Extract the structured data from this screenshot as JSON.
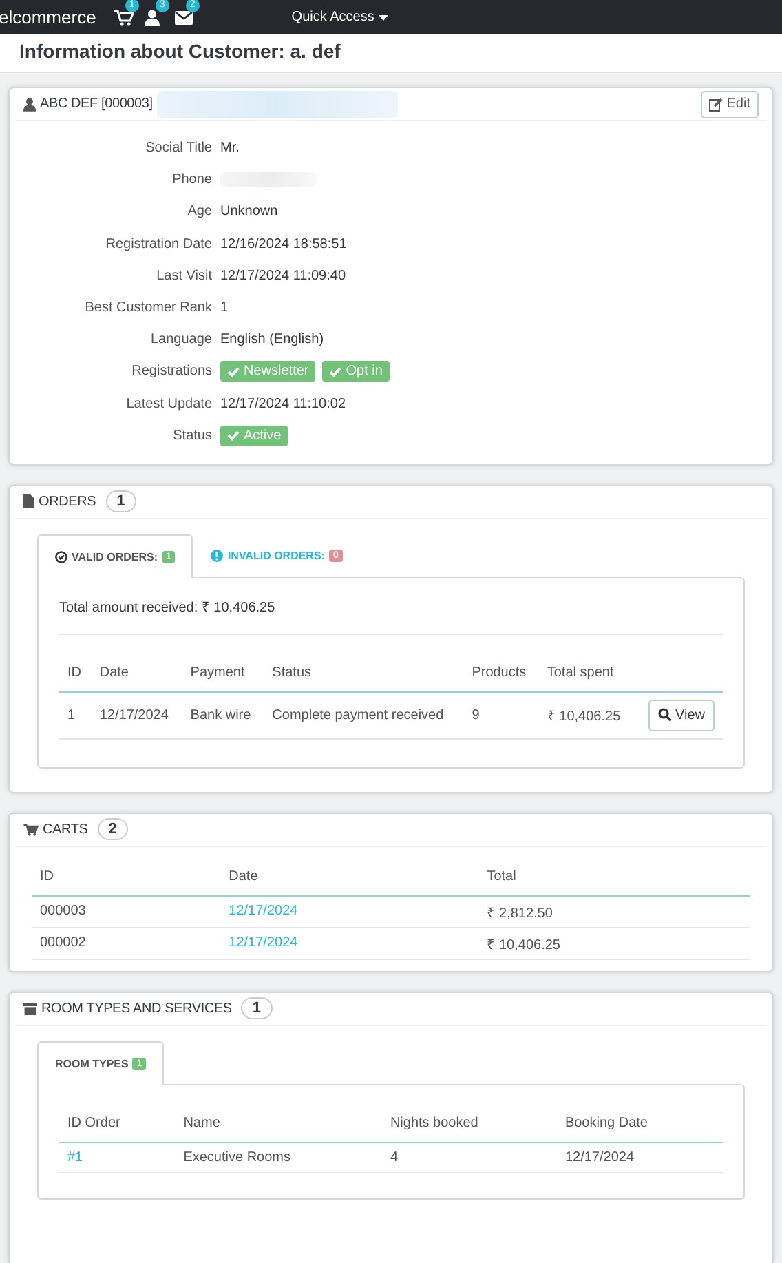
{
  "topbar": {
    "brand": "elcommerce",
    "icons": [
      {
        "kind": "cart",
        "count": "1"
      },
      {
        "kind": "user",
        "count": "3"
      },
      {
        "kind": "mail",
        "count": "2"
      }
    ],
    "quick_access": "Quick Access"
  },
  "page_title": "Information about Customer: a. def",
  "customer": {
    "heading": "ABC DEF [000003]",
    "edit": "Edit",
    "fields": [
      {
        "label": "Social Title",
        "kind": "text",
        "value": "Mr."
      },
      {
        "label": "Phone",
        "kind": "blurred"
      },
      {
        "label": "Age",
        "kind": "text",
        "value": "Unknown"
      },
      {
        "label": "Registration Date",
        "kind": "text",
        "value": "12/16/2024 18:58:51"
      },
      {
        "label": "Last Visit",
        "kind": "text",
        "value": "12/17/2024 11:09:40"
      },
      {
        "label": "Best Customer Rank",
        "kind": "text",
        "value": "1"
      },
      {
        "label": "Language",
        "kind": "text",
        "value": "English (English)"
      },
      {
        "label": "Registrations",
        "kind": "badges",
        "badges": [
          "Newsletter",
          "Opt in"
        ]
      },
      {
        "label": "Latest Update",
        "kind": "text",
        "value": "12/17/2024 11:10:02"
      },
      {
        "label": "Status",
        "kind": "badges",
        "badges": [
          "Active"
        ]
      }
    ]
  },
  "orders": {
    "heading": "ORDERS",
    "count": "1",
    "tabs": [
      {
        "label": "VALID ORDERS:",
        "count": "1",
        "kind": "valid",
        "selected": true
      },
      {
        "label": "INVALID ORDERS:",
        "count": "0",
        "kind": "invalid",
        "selected": false
      }
    ],
    "total": "Total amount received: ₹ 10,406.25",
    "columns": [
      "ID",
      "Date",
      "Payment",
      "Status",
      "Products",
      "Total spent"
    ],
    "rows": [
      {
        "cells": [
          "1",
          "12/17/2024",
          "Bank wire",
          "Complete payment received",
          "9",
          "₹ 10,406.25"
        ],
        "action": "View"
      }
    ]
  },
  "carts": {
    "heading": "CARTS",
    "count": "2",
    "columns": [
      "ID",
      "Date",
      "Total"
    ],
    "rows": [
      [
        "000003",
        "12/17/2024",
        "₹ 2,812.50"
      ],
      [
        "000002",
        "12/17/2024",
        "₹ 10,406.25"
      ]
    ]
  },
  "rooms": {
    "heading": "ROOM TYPES AND SERVICES",
    "count": "1",
    "tabs": [
      {
        "label": "ROOM TYPES",
        "count": "1",
        "selected": true
      }
    ],
    "columns": [
      "ID Order",
      "Name",
      "Nights booked",
      "Booking Date"
    ],
    "rows": [
      [
        "#1",
        "Executive Rooms",
        "4",
        "12/17/2024"
      ]
    ]
  }
}
